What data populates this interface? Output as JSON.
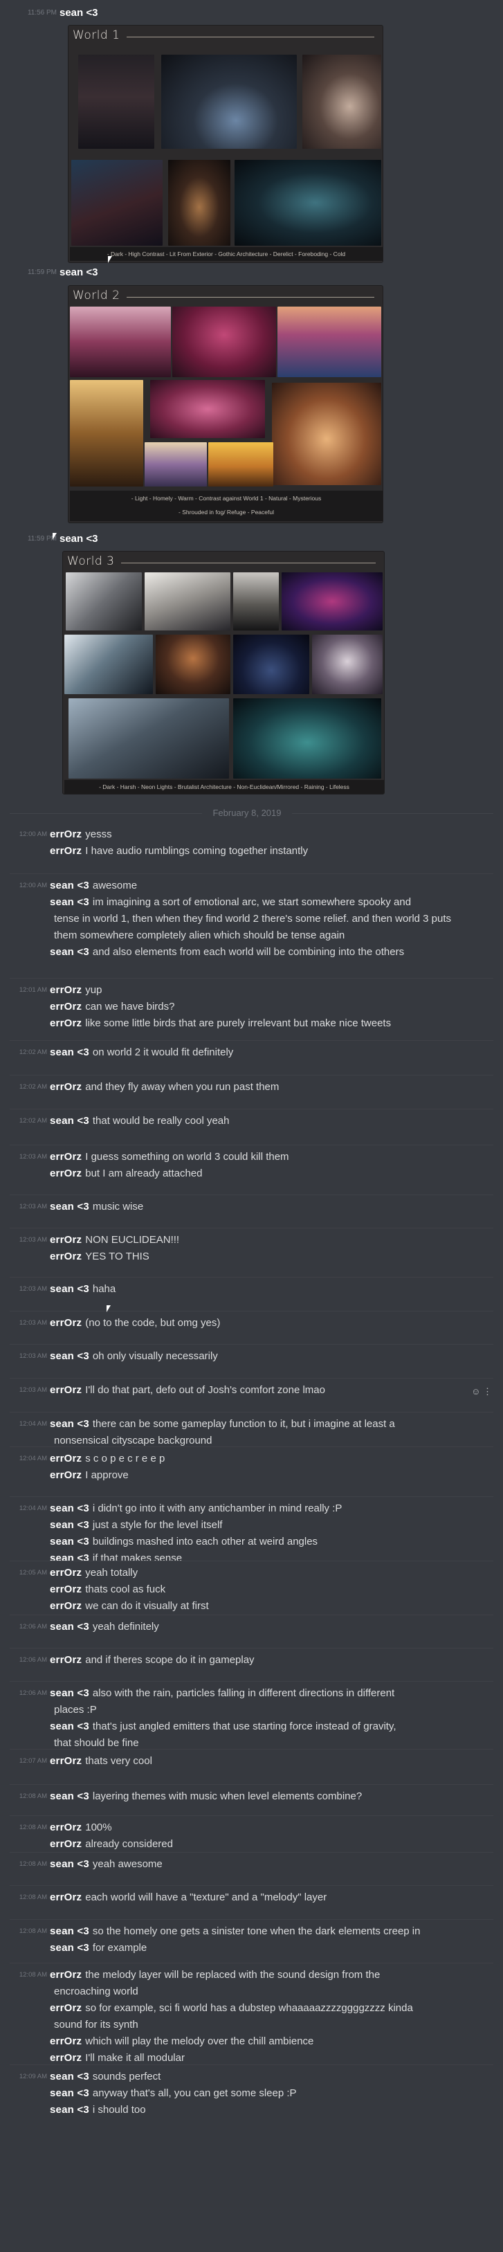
{
  "accent": "#ffffff",
  "posts": [
    {
      "time": "11:56 PM",
      "author": "sean <3"
    },
    {
      "time": "11:59 PM",
      "author": "sean <3"
    },
    {
      "time": "11:59 PM",
      "author": "sean <3"
    }
  ],
  "worlds": [
    {
      "title": "World 1",
      "tags": "- Dark  - High Contrast  - Lit From Exterior  - Gothic Architecture  - Derelict  - Foreboding  - Cold"
    },
    {
      "title": "World 2",
      "tags_line1": "- Light  - Homely  - Warm  - Contrast against World 1  - Natural  - Mysterious",
      "tags_line2": "- Shrouded in fog/ Refuge  - Peaceful"
    },
    {
      "title": "World 3",
      "tags": "- Dark  - Harsh  - Neon Lights  - Brutalist Architecture  - Non-Euclidean/Mirrored  - Raining  - Lifeless"
    }
  ],
  "date_divider": "February 8, 2019",
  "messages": [
    {
      "time": "12:00 AM",
      "lines": [
        {
          "a": "errOrz",
          "t": "yesss"
        },
        {
          "a": "errOrz",
          "t": "I have audio rumblings coming together instantly"
        }
      ]
    },
    {
      "time": "12:00 AM",
      "lines": [
        {
          "a": "sean <3",
          "t": "awesome"
        },
        {
          "a": "sean <3",
          "t": "im imagining a sort of emotional arc, we start somewhere spooky and"
        },
        {
          "a": "",
          "t": "tense in world 1, then when they find world 2 there's some relief. and then world 3 puts"
        },
        {
          "a": "",
          "t": "them somewhere completely alien which should be tense again"
        },
        {
          "a": "sean <3",
          "t": "and also elements from each world will be combining into the others"
        }
      ]
    },
    {
      "time": "12:01 AM",
      "lines": [
        {
          "a": "errOrz",
          "t": "yup"
        },
        {
          "a": "errOrz",
          "t": "can we have birds?"
        },
        {
          "a": "errOrz",
          "t": "like some little birds that are purely irrelevant but make nice tweets"
        }
      ]
    },
    {
      "time": "12:02 AM",
      "lines": [
        {
          "a": "sean <3",
          "t": "on world 2 it would fit definitely"
        }
      ]
    },
    {
      "time": "12:02 AM",
      "lines": [
        {
          "a": "errOrz",
          "t": "and they fly away when you run past them"
        }
      ]
    },
    {
      "time": "12:02 AM",
      "lines": [
        {
          "a": "sean <3",
          "t": "that would be really cool yeah"
        }
      ]
    },
    {
      "time": "12:03 AM",
      "lines": [
        {
          "a": "errOrz",
          "t": "I guess something on world 3 could kill them"
        },
        {
          "a": "errOrz",
          "t": "but I am already attached"
        }
      ]
    },
    {
      "time": "12:03 AM",
      "lines": [
        {
          "a": "sean <3",
          "t": "music wise"
        }
      ]
    },
    {
      "time": "12:03 AM",
      "lines": [
        {
          "a": "errOrz",
          "t": "NON EUCLIDEAN!!!"
        },
        {
          "a": "errOrz",
          "t": "YES TO THIS"
        }
      ]
    },
    {
      "time": "12:03 AM",
      "lines": [
        {
          "a": "sean <3",
          "t": "haha"
        }
      ]
    },
    {
      "time": "12:03 AM",
      "lines": [
        {
          "a": "errOrz",
          "t": "(no to the code, but omg yes)"
        }
      ]
    },
    {
      "time": "12:03 AM",
      "lines": [
        {
          "a": "sean <3",
          "t": "oh only visually necessarily"
        }
      ]
    },
    {
      "time": "12:03 AM",
      "lines": [
        {
          "a": "errOrz",
          "t": "I'll do that part, defo out of Josh's comfort zone lmao"
        }
      ]
    },
    {
      "time": "12:04 AM",
      "lines": [
        {
          "a": "sean <3",
          "t": "there can be some gameplay function to it, but i imagine at least a"
        },
        {
          "a": "",
          "t": "nonsensical cityscape background"
        }
      ]
    },
    {
      "time": "12:04 AM",
      "lines": [
        {
          "a": "errOrz",
          "t": "s c o p e c r e e p"
        },
        {
          "a": "errOrz",
          "t": "I approve"
        }
      ]
    },
    {
      "time": "12:04 AM",
      "lines": [
        {
          "a": "sean <3",
          "t": "i didn't go into it with any antichamber in mind really :P"
        },
        {
          "a": "sean <3",
          "t": "just a style for the level itself"
        },
        {
          "a": "sean <3",
          "t": "buildings mashed into each other at weird angles"
        },
        {
          "a": "sean <3",
          "t": "if that makes sense"
        }
      ]
    },
    {
      "time": "12:05 AM",
      "lines": [
        {
          "a": "errOrz",
          "t": "yeah totally"
        },
        {
          "a": "errOrz",
          "t": "thats cool as fuck"
        },
        {
          "a": "errOrz",
          "t": "we can do it visually at first"
        }
      ]
    },
    {
      "time": "12:06 AM",
      "lines": [
        {
          "a": "sean <3",
          "t": "yeah definitely"
        }
      ]
    },
    {
      "time": "12:06 AM",
      "lines": [
        {
          "a": "errOrz",
          "t": "and if theres scope do it in gameplay"
        }
      ]
    },
    {
      "time": "12:06 AM",
      "lines": [
        {
          "a": "sean <3",
          "t": "also with the rain, particles falling in different directions in different"
        },
        {
          "a": "",
          "t": "places :P"
        },
        {
          "a": "sean <3",
          "t": "that's just angled emitters that use starting force instead of gravity,"
        },
        {
          "a": "",
          "t": "that should be fine"
        }
      ]
    },
    {
      "time": "12:07 AM",
      "lines": [
        {
          "a": "errOrz",
          "t": "thats very cool"
        }
      ]
    },
    {
      "time": "12:08 AM",
      "lines": [
        {
          "a": "sean <3",
          "t": "layering themes with music when level elements combine?"
        }
      ]
    },
    {
      "time": "12:08 AM",
      "lines": [
        {
          "a": "errOrz",
          "t": "100%"
        },
        {
          "a": "errOrz",
          "t": "already considered"
        }
      ]
    },
    {
      "time": "12:08 AM",
      "lines": [
        {
          "a": "sean <3",
          "t": "yeah awesome"
        }
      ]
    },
    {
      "time": "12:08 AM",
      "lines": [
        {
          "a": "errOrz",
          "t": "each world will have a \"texture\" and a \"melody\" layer"
        }
      ]
    },
    {
      "time": "12:08 AM",
      "lines": [
        {
          "a": "sean <3",
          "t": "so the homely one gets a sinister tone when the dark elements creep in"
        },
        {
          "a": "sean <3",
          "t": "for example"
        }
      ]
    },
    {
      "time": "12:08 AM",
      "lines": [
        {
          "a": "errOrz",
          "t": "the melody layer will be replaced with the sound design from the"
        },
        {
          "a": "",
          "t": "encroaching world"
        },
        {
          "a": "errOrz",
          "t": "so for example, sci fi world has a dubstep whaaaaazzzzggggzzzz kinda"
        },
        {
          "a": "",
          "t": "sound for its synth"
        },
        {
          "a": "errOrz",
          "t": "which will play the melody over the chill ambience"
        },
        {
          "a": "errOrz",
          "t": "I'll make it all modular"
        }
      ]
    },
    {
      "time": "12:09 AM",
      "lines": [
        {
          "a": "sean <3",
          "t": "sounds perfect"
        },
        {
          "a": "sean <3",
          "t": "anyway that's all, you can get some sleep :P"
        },
        {
          "a": "sean <3",
          "t": "i should too"
        }
      ]
    }
  ]
}
